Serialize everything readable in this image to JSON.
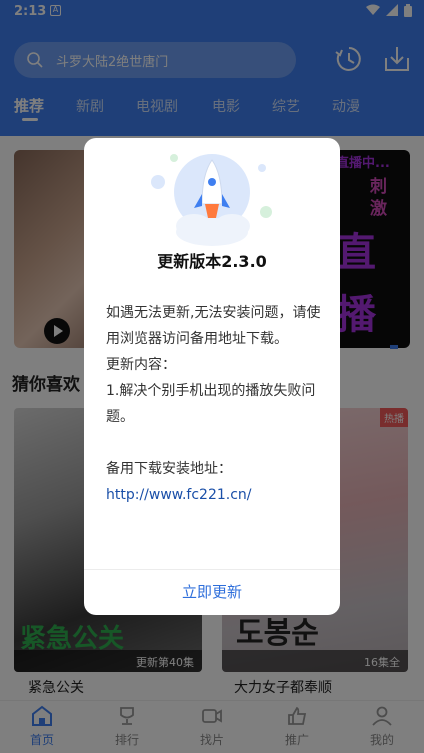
{
  "status_bar": {
    "time": "2:13",
    "notification_icon": "A"
  },
  "header": {
    "search_placeholder": "斗罗大陆2绝世唐门",
    "tabs": [
      "推荐",
      "新剧",
      "电视剧",
      "电影",
      "综艺",
      "动漫"
    ],
    "active_tab": 0
  },
  "banner": {
    "right_texts": [
      "直播中...",
      "刺",
      "激",
      "直",
      "播"
    ]
  },
  "section": {
    "title": "猜你喜欢"
  },
  "cards": [
    {
      "poster_text": "紧急公关",
      "caption": "更新第40集",
      "title": "紧急公关"
    },
    {
      "poster_text": "도봉순",
      "caption": "16集全",
      "badge": "热播",
      "title": "大力女子都奉顺"
    }
  ],
  "bottom_nav": {
    "items": [
      "首页",
      "排行",
      "找片",
      "推广",
      "我的"
    ],
    "active": 0
  },
  "dialog": {
    "title": "更新版本2.3.0",
    "body": [
      "如遇无法更新,无法安装问题，请使用浏览器访问备用地址下载。",
      "更新内容：",
      "1.解决个别手机出现的播放失败问题。",
      "",
      "备用下载安装地址："
    ],
    "link": "http://www.fc221.cn/",
    "button": "立即更新"
  },
  "colors": {
    "brand": "#3f7ff0",
    "dialog_button": "#2f6fdb",
    "link": "#1a4fa8"
  }
}
